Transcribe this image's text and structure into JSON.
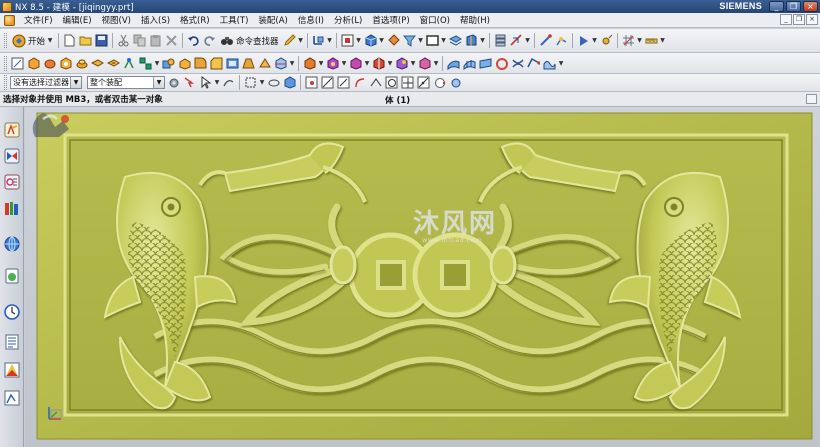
{
  "window": {
    "title": "NX 8.5 - 建模 - [jiqingyy.prt]",
    "brand": "SIEMENS",
    "controls": [
      "_",
      "❐",
      "×"
    ]
  },
  "menubar": {
    "items": [
      "文件(F)",
      "编辑(E)",
      "视图(V)",
      "插入(S)",
      "格式(R)",
      "工具(T)",
      "装配(A)",
      "信息(I)",
      "分析(L)",
      "首选项(P)",
      "窗口(O)",
      "帮助(H)"
    ],
    "doc_controls": [
      "_",
      "❐",
      "×"
    ]
  },
  "toolbar1": {
    "start_label": "开始",
    "command_finder_label": "命令查找器"
  },
  "selection_bar": {
    "filter_value": "没有选择过滤器",
    "assembly_value": "整个装配"
  },
  "status": {
    "prompt": "选择对象并使用 MB3，或者双击某一对象",
    "center": "体 (1)"
  },
  "watermark": {
    "text": "沐风网",
    "sub": "www.mfcad.com"
  },
  "colors": {
    "titlebar": "#2c4f83",
    "relief": "#b8bd4f",
    "relief_shadow": "#7e8428",
    "relief_highlight": "#dfe28b"
  }
}
